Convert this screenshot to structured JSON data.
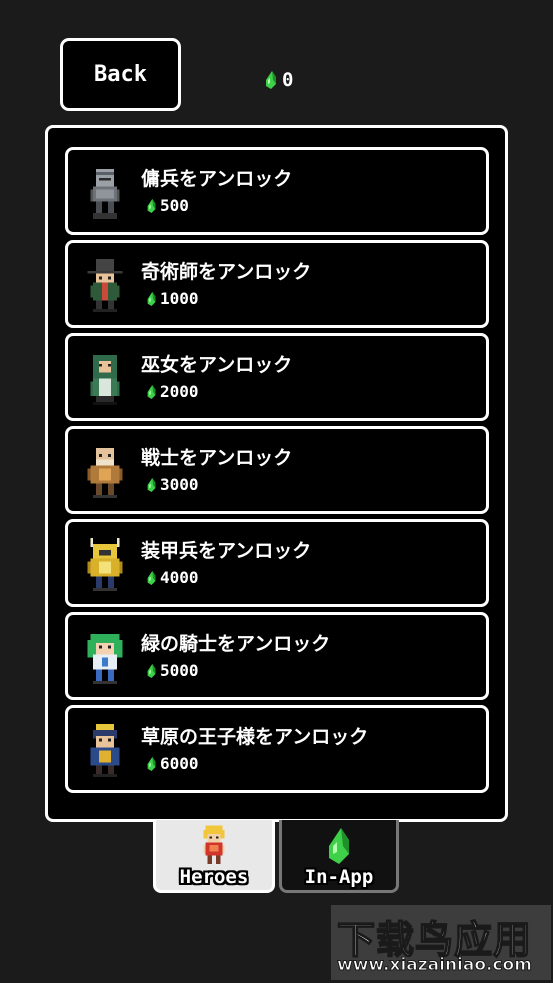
{
  "header": {
    "back_label": "Back",
    "currency_amount": "0",
    "currency_icon": "green-gem-icon"
  },
  "colors": {
    "background": "#1b1b1b",
    "panel": "#000000",
    "border": "#ffffff",
    "gem": "#3fd04a",
    "active_tab": "#e8e8e8"
  },
  "heroes": [
    {
      "title": "傭兵をアンロック",
      "price": "500",
      "icon": "mercenary-sprite-icon"
    },
    {
      "title": "奇術師をアンロック",
      "price": "1000",
      "icon": "magician-sprite-icon"
    },
    {
      "title": "巫女をアンロック",
      "price": "2000",
      "icon": "shrine-maiden-sprite-icon"
    },
    {
      "title": "戦士をアンロック",
      "price": "3000",
      "icon": "warrior-sprite-icon"
    },
    {
      "title": "装甲兵をアンロック",
      "price": "4000",
      "icon": "armored-soldier-sprite-icon"
    },
    {
      "title": "緑の騎士をアンロック",
      "price": "5000",
      "icon": "green-knight-sprite-icon"
    },
    {
      "title": "草原の王子様をアンロック",
      "price": "6000",
      "icon": "meadow-prince-sprite-icon"
    }
  ],
  "tabs": [
    {
      "label": "Heroes",
      "icon": "hero-sprite-icon",
      "active": true
    },
    {
      "label": "In-App",
      "icon": "green-gem-icon",
      "active": false
    }
  ],
  "watermark": {
    "main": "下载鸟应用",
    "url": "www.xiazainiao.com"
  }
}
